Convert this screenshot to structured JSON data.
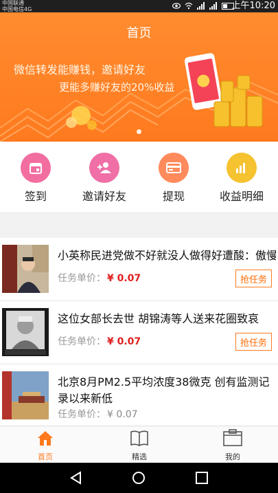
{
  "status_bar": {
    "carrier_line1": "中国联通",
    "carrier_line2": "中国电信4G",
    "time": "上午10:20"
  },
  "header": {
    "title": "首页"
  },
  "banner": {
    "line1": "微信转发能赚钱，邀请好友",
    "line2": "更能多赚好友的20%收益"
  },
  "menu": {
    "items": [
      {
        "label": "签到",
        "icon": "calendar-icon",
        "color": "#f26ea0"
      },
      {
        "label": "邀请好友",
        "icon": "add-person-icon",
        "color": "#ef6fa6"
      },
      {
        "label": "提现",
        "icon": "card-icon",
        "color": "#ff8a5c"
      },
      {
        "label": "收益明细",
        "icon": "bar-chart-icon",
        "color": "#f5c230"
      }
    ]
  },
  "tasks": {
    "price_label": "任务单价：",
    "grab_label": "抢任务",
    "items": [
      {
        "headline": "小英称民进党做不好就没人做得好遭酸：傲慢",
        "price": "¥ 0.07"
      },
      {
        "headline": "这位女部长去世 胡锦涛等人送来花圈致哀",
        "price": "¥ 0.07"
      },
      {
        "headline": "北京8月PM2.5平均浓度38微克 创有监测记录以来新低",
        "price": "¥ 0.07"
      }
    ]
  },
  "tabbar": {
    "tabs": [
      {
        "label": "首页",
        "icon": "home-icon"
      },
      {
        "label": "精选",
        "icon": "book-icon"
      },
      {
        "label": "我的",
        "icon": "clipboard-icon"
      }
    ]
  },
  "colors": {
    "accent": "#ff7a1f",
    "price_red": "#e02020"
  }
}
